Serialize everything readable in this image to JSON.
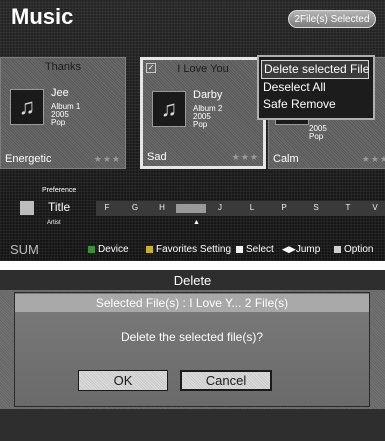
{
  "header": {
    "title": "Music",
    "selection_badge": "2File(s) Selected"
  },
  "cards": [
    {
      "title": "Thanks",
      "artist": "Jee",
      "album": "Album 1",
      "year": "2005",
      "genre": "Pop",
      "mood": "Energetic",
      "stars": "★★★"
    },
    {
      "title": "I Love You",
      "artist": "Darby",
      "album": "Album 2",
      "year": "2005",
      "genre": "Pop",
      "mood": "Sad",
      "stars": "★★★",
      "checked": "✓"
    },
    {
      "title": "",
      "artist": "",
      "album": "",
      "year": "2005",
      "genre": "Pop",
      "mood": "Calm",
      "stars": "★★★"
    }
  ],
  "popup_menu": {
    "items": [
      "Delete selected File",
      "Deselect All",
      "Safe Remove"
    ],
    "highlighted_index": 0
  },
  "sort_bar": {
    "preference_label": "Preference",
    "title_label": "Title",
    "artist_label": "Artist",
    "letters": [
      "F",
      "G",
      "H",
      "",
      "J",
      "L",
      "P",
      "S",
      "T",
      "V"
    ],
    "highlighted_index": 3,
    "pointer": "▲"
  },
  "bottom_bar": {
    "sum_label": "SUM",
    "device_label": "Device",
    "favorites_label": "Favorites Setting",
    "select_label": "Select",
    "jump_label": "Jump",
    "jump_icon": "◀▶",
    "option_label": "Option",
    "colors": {
      "green": "#3f8f3a",
      "yellow": "#c9b02c",
      "blue": "#3a5bb0",
      "white": "#f0f0f0"
    }
  },
  "dialog": {
    "title": "Delete",
    "subhead": "Selected File(s) : I Love Y...  2 File(s)",
    "message": "Delete the selected file(s)?",
    "ok_label": "OK",
    "cancel_label": "Cancel"
  },
  "icons": {
    "music_note": "♫",
    "checkbox": "checkmark-icon",
    "sort": "sort-icon"
  }
}
